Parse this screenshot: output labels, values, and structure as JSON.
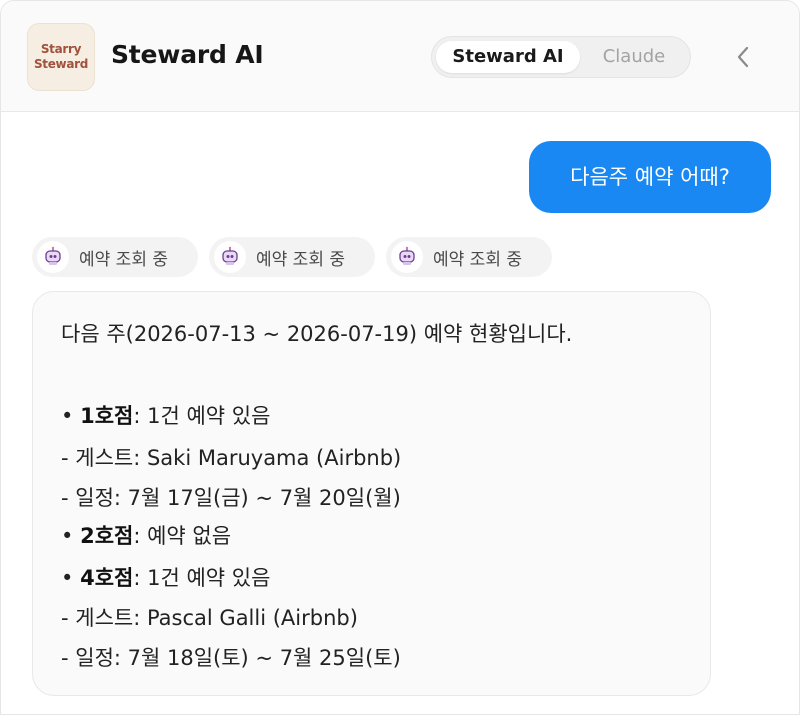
{
  "header": {
    "logo_line1": "Starry",
    "logo_line2": "Steward",
    "title": "Steward AI",
    "tabs": [
      {
        "label": "Steward AI",
        "active": true
      },
      {
        "label": "Claude",
        "active": false
      }
    ],
    "back_icon": "chevron-left-icon"
  },
  "user_message": "다음주 예약 어때?",
  "chips": [
    {
      "label": "예약 조회 중",
      "icon": "robot-icon"
    },
    {
      "label": "예약 조회 중",
      "icon": "robot-icon"
    },
    {
      "label": "예약 조회 중",
      "icon": "robot-icon"
    }
  ],
  "reply": {
    "intro": "다음 주(2026-07-13 ~ 2026-07-19) 예약 현황입니다.",
    "items": [
      {
        "bullet": "•",
        "name": "1호점",
        "status": ": 1건 예약 있음"
      },
      {
        "bullet": "•",
        "name": "2호점",
        "status": ": 예약 없음"
      },
      {
        "bullet": "•",
        "name": "4호점",
        "status": ": 1건 예약 있음"
      }
    ],
    "details": [
      "- 게스트: Saki Maruyama (Airbnb)",
      "- 일정: 7월 17일(금) ~ 7월 20일(월)",
      "- 게스트: Pascal Galli (Airbnb)",
      "- 일정: 7월 18일(토) ~ 7월 25일(토)"
    ]
  },
  "colors": {
    "user_bubble": "#1a88f2",
    "logo_text": "#a0523c",
    "chip_bg": "#f3f3f3"
  }
}
